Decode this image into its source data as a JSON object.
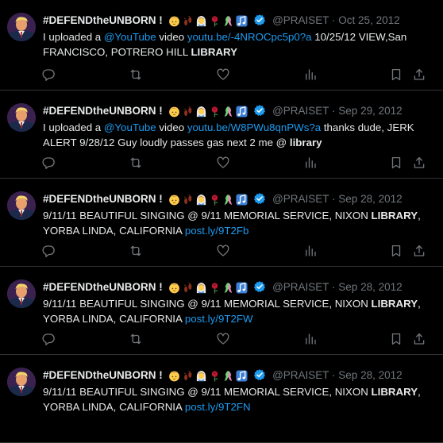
{
  "tweets": [
    {
      "display_name": "#DEFENDtheUNBORN !",
      "handle": "@PRAISET",
      "date": "Oct 25, 2012",
      "text": {
        "pre": "I uploaded a ",
        "link1": "@YouTube",
        "mid": " video ",
        "link2": "youtu.be/-4NROCpc5p0?a",
        "post": " 10/25/12 VIEW,San FRANCISCO, POTRERO HILL ",
        "bold": "LIBRARY",
        "tail": ""
      }
    },
    {
      "display_name": "#DEFENDtheUNBORN !",
      "handle": "@PRAISET",
      "date": "Sep 29, 2012",
      "text": {
        "pre": "I uploaded a ",
        "link1": "@YouTube",
        "mid": " video ",
        "link2": "youtu.be/W8PWu8qnPWs?a",
        "post": " thanks dude, JERK ALERT 9/28/12 Guy loudly passes gas next 2 me @ ",
        "bold": "library",
        "tail": ""
      }
    },
    {
      "display_name": "#DEFENDtheUNBORN !",
      "handle": "@PRAISET",
      "date": "Sep 28, 2012",
      "text": {
        "pre": "9/11/11 BEAUTIFUL SINGING @ 9/11 MEMORIAL SERVICE, NIXON ",
        "bold": "LIBRARY",
        "post": ", YORBA LINDA, CALIFORNIA ",
        "link": "post.ly/9T2Fb"
      }
    },
    {
      "display_name": "#DEFENDtheUNBORN !",
      "handle": "@PRAISET",
      "date": "Sep 28, 2012",
      "text": {
        "pre": "9/11/11 BEAUTIFUL SINGING @ 9/11 MEMORIAL SERVICE, NIXON ",
        "bold": "LIBRARY",
        "post": ", YORBA LINDA, CALIFORNIA ",
        "link": "post.ly/9T2FW"
      }
    },
    {
      "display_name": "#DEFENDtheUNBORN !",
      "handle": "@PRAISET",
      "date": "Sep 28, 2012",
      "text": {
        "pre": "9/11/11 BEAUTIFUL SINGING @ 9/11 MEMORIAL SERVICE, NIXON ",
        "bold": "LIBRARY",
        "post": ", YORBA LINDA, CALIFORNIA ",
        "link": "post.ly/9T2FN"
      }
    }
  ],
  "separator": " · ",
  "colors": {
    "background": "#000000",
    "text": "#e7e9ea",
    "muted": "#71767b",
    "link": "#1d9bf0",
    "border": "#2f3336",
    "verified": "#1d9bf0"
  },
  "icons": {
    "name_emojis": [
      "baby-face-icon",
      "footprints-icon",
      "person-with-veil-icon",
      "rose-icon",
      "ribbon-icon",
      "music-notes-icon"
    ],
    "verified": "verified-badge-icon",
    "actions": [
      "reply-icon",
      "retweet-icon",
      "like-icon",
      "views-icon",
      "bookmark-icon",
      "share-icon"
    ]
  }
}
